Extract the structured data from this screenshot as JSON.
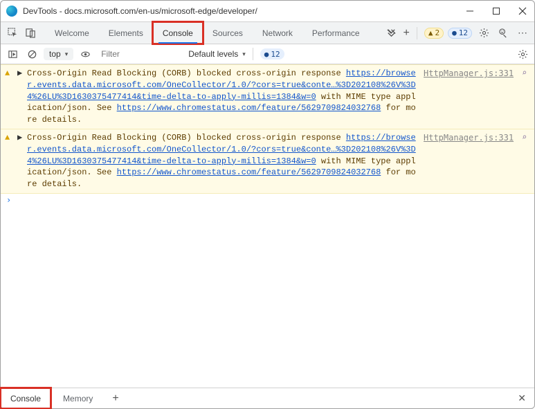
{
  "window": {
    "title": "DevTools - docs.microsoft.com/en-us/microsoft-edge/developer/"
  },
  "tabs": {
    "welcome": "Welcome",
    "elements": "Elements",
    "console": "Console",
    "sources": "Sources",
    "network": "Network",
    "performance": "Performance"
  },
  "counters": {
    "warnings": "2",
    "verbose": "12",
    "visible": "12"
  },
  "subbar": {
    "context": "top",
    "filter_placeholder": "Filter",
    "levels": "Default levels"
  },
  "log1": {
    "part1": "Cross-Origin Read Blocking (CORB) blocked cross-origin response ",
    "url1": "https://browser.events.data.microsoft.com/OneCollector/1.0/?cors=true&conte…%3D202108%26V%3D4%26LU%3D1630375477414&time-delta-to-apply-millis=1384&w=0",
    "part2": " with MIME type application/json. See ",
    "url2": "https://www.chromestatus.com/feature/5629709824032768",
    "part3": " for more details.",
    "source": "HttpManager.js:331"
  },
  "log2": {
    "part1": "Cross-Origin Read Blocking (CORB) blocked cross-origin response ",
    "url1": "https://browser.events.data.microsoft.com/OneCollector/1.0/?cors=true&conte…%3D202108%26V%3D4%26LU%3D1630375477414&time-delta-to-apply-millis=1384&w=0",
    "part2": " with MIME type application/json. See ",
    "url2": "https://www.chromestatus.com/feature/5629709824032768",
    "part3": " for more details.",
    "source": "HttpManager.js:331"
  },
  "prompt": "›",
  "drawer": {
    "console": "Console",
    "memory": "Memory"
  }
}
